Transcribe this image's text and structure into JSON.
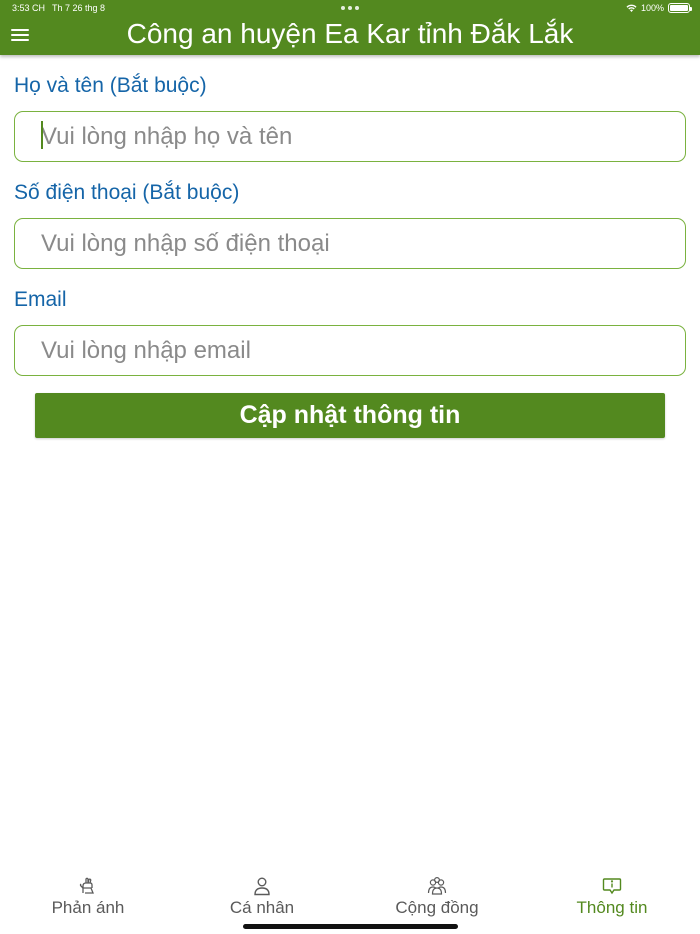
{
  "status_bar": {
    "time": "3:53 CH",
    "date": "Th 7 26 thg 8",
    "battery": "100%"
  },
  "header": {
    "title": "Công an huyện Ea Kar tỉnh Đắk Lắk",
    "background_color": "#53891f"
  },
  "form": {
    "fields": [
      {
        "label": "Họ và tên (Bắt buộc)",
        "placeholder": "Vui lòng nhập họ và tên",
        "value": ""
      },
      {
        "label": "Số điện thoại (Bắt buộc)",
        "placeholder": "Vui lòng nhập số điện thoại",
        "value": ""
      },
      {
        "label": "Email",
        "placeholder": "Vui lòng nhập email",
        "value": ""
      }
    ],
    "submit_label": "Cập nhật thông tin",
    "label_color": "#1565a8",
    "border_color": "#7ab23f"
  },
  "tab_bar": {
    "active_index": 3,
    "tabs": [
      {
        "label": "Phản ánh",
        "icon": "report-icon"
      },
      {
        "label": "Cá nhân",
        "icon": "person-icon"
      },
      {
        "label": "Cộng đồng",
        "icon": "community-icon"
      },
      {
        "label": "Thông tin",
        "icon": "info-message-icon"
      }
    ]
  }
}
